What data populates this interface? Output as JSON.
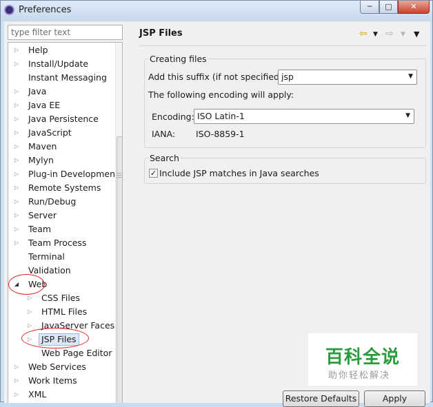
{
  "window": {
    "title": "Preferences"
  },
  "filter": {
    "placeholder": "type filter text"
  },
  "tree": {
    "items": [
      {
        "label": "Help",
        "twisty": "collapsed"
      },
      {
        "label": "Install/Update",
        "twisty": "collapsed"
      },
      {
        "label": "Instant Messaging",
        "twisty": "none"
      },
      {
        "label": "Java",
        "twisty": "collapsed"
      },
      {
        "label": "Java EE",
        "twisty": "collapsed"
      },
      {
        "label": "Java Persistence",
        "twisty": "collapsed"
      },
      {
        "label": "JavaScript",
        "twisty": "collapsed"
      },
      {
        "label": "Maven",
        "twisty": "collapsed"
      },
      {
        "label": "Mylyn",
        "twisty": "collapsed"
      },
      {
        "label": "Plug-in Development",
        "twisty": "collapsed"
      },
      {
        "label": "Remote Systems",
        "twisty": "collapsed"
      },
      {
        "label": "Run/Debug",
        "twisty": "collapsed"
      },
      {
        "label": "Server",
        "twisty": "collapsed"
      },
      {
        "label": "Team",
        "twisty": "collapsed"
      },
      {
        "label": "Team Process",
        "twisty": "collapsed"
      },
      {
        "label": "Terminal",
        "twisty": "none"
      },
      {
        "label": "Validation",
        "twisty": "none"
      },
      {
        "label": "Web",
        "twisty": "expanded"
      },
      {
        "label": "CSS Files",
        "twisty": "collapsed",
        "child": true
      },
      {
        "label": "HTML Files",
        "twisty": "collapsed",
        "child": true
      },
      {
        "label": "JavaServer Faces T",
        "twisty": "collapsed",
        "child": true
      },
      {
        "label": "JSP Files",
        "twisty": "collapsed",
        "child": true,
        "selected": true
      },
      {
        "label": "Web Page Editor",
        "twisty": "none",
        "child": true
      },
      {
        "label": "Web Services",
        "twisty": "collapsed"
      },
      {
        "label": "Work Items",
        "twisty": "collapsed"
      },
      {
        "label": "XML",
        "twisty": "collapsed"
      }
    ]
  },
  "page": {
    "title": "JSP Files",
    "nav_icons": [
      "back-arrow-icon",
      "forward-arrow-icon",
      "view-menu-icon"
    ]
  },
  "creating_files": {
    "title": "Creating files",
    "suffix_label": "Add this suffix (if not specified):",
    "suffix_value": "jsp",
    "encoding_note": "The following encoding will apply:",
    "encoding_label": "Encoding:",
    "encoding_value": "ISO Latin-1",
    "iana_label": "IANA:",
    "iana_value": "ISO-8859-1"
  },
  "search": {
    "title": "Search",
    "include_label": "Include JSP matches in Java searches",
    "include_checked": true
  },
  "buttons": {
    "restore": "Restore Defaults",
    "apply": "Apply"
  },
  "watermark": {
    "mark": "百科全说",
    "sub": "助你轻松解决"
  },
  "colors": {
    "annotation_ring": "#e0242a",
    "watermark_green": "#2a9c3d"
  }
}
